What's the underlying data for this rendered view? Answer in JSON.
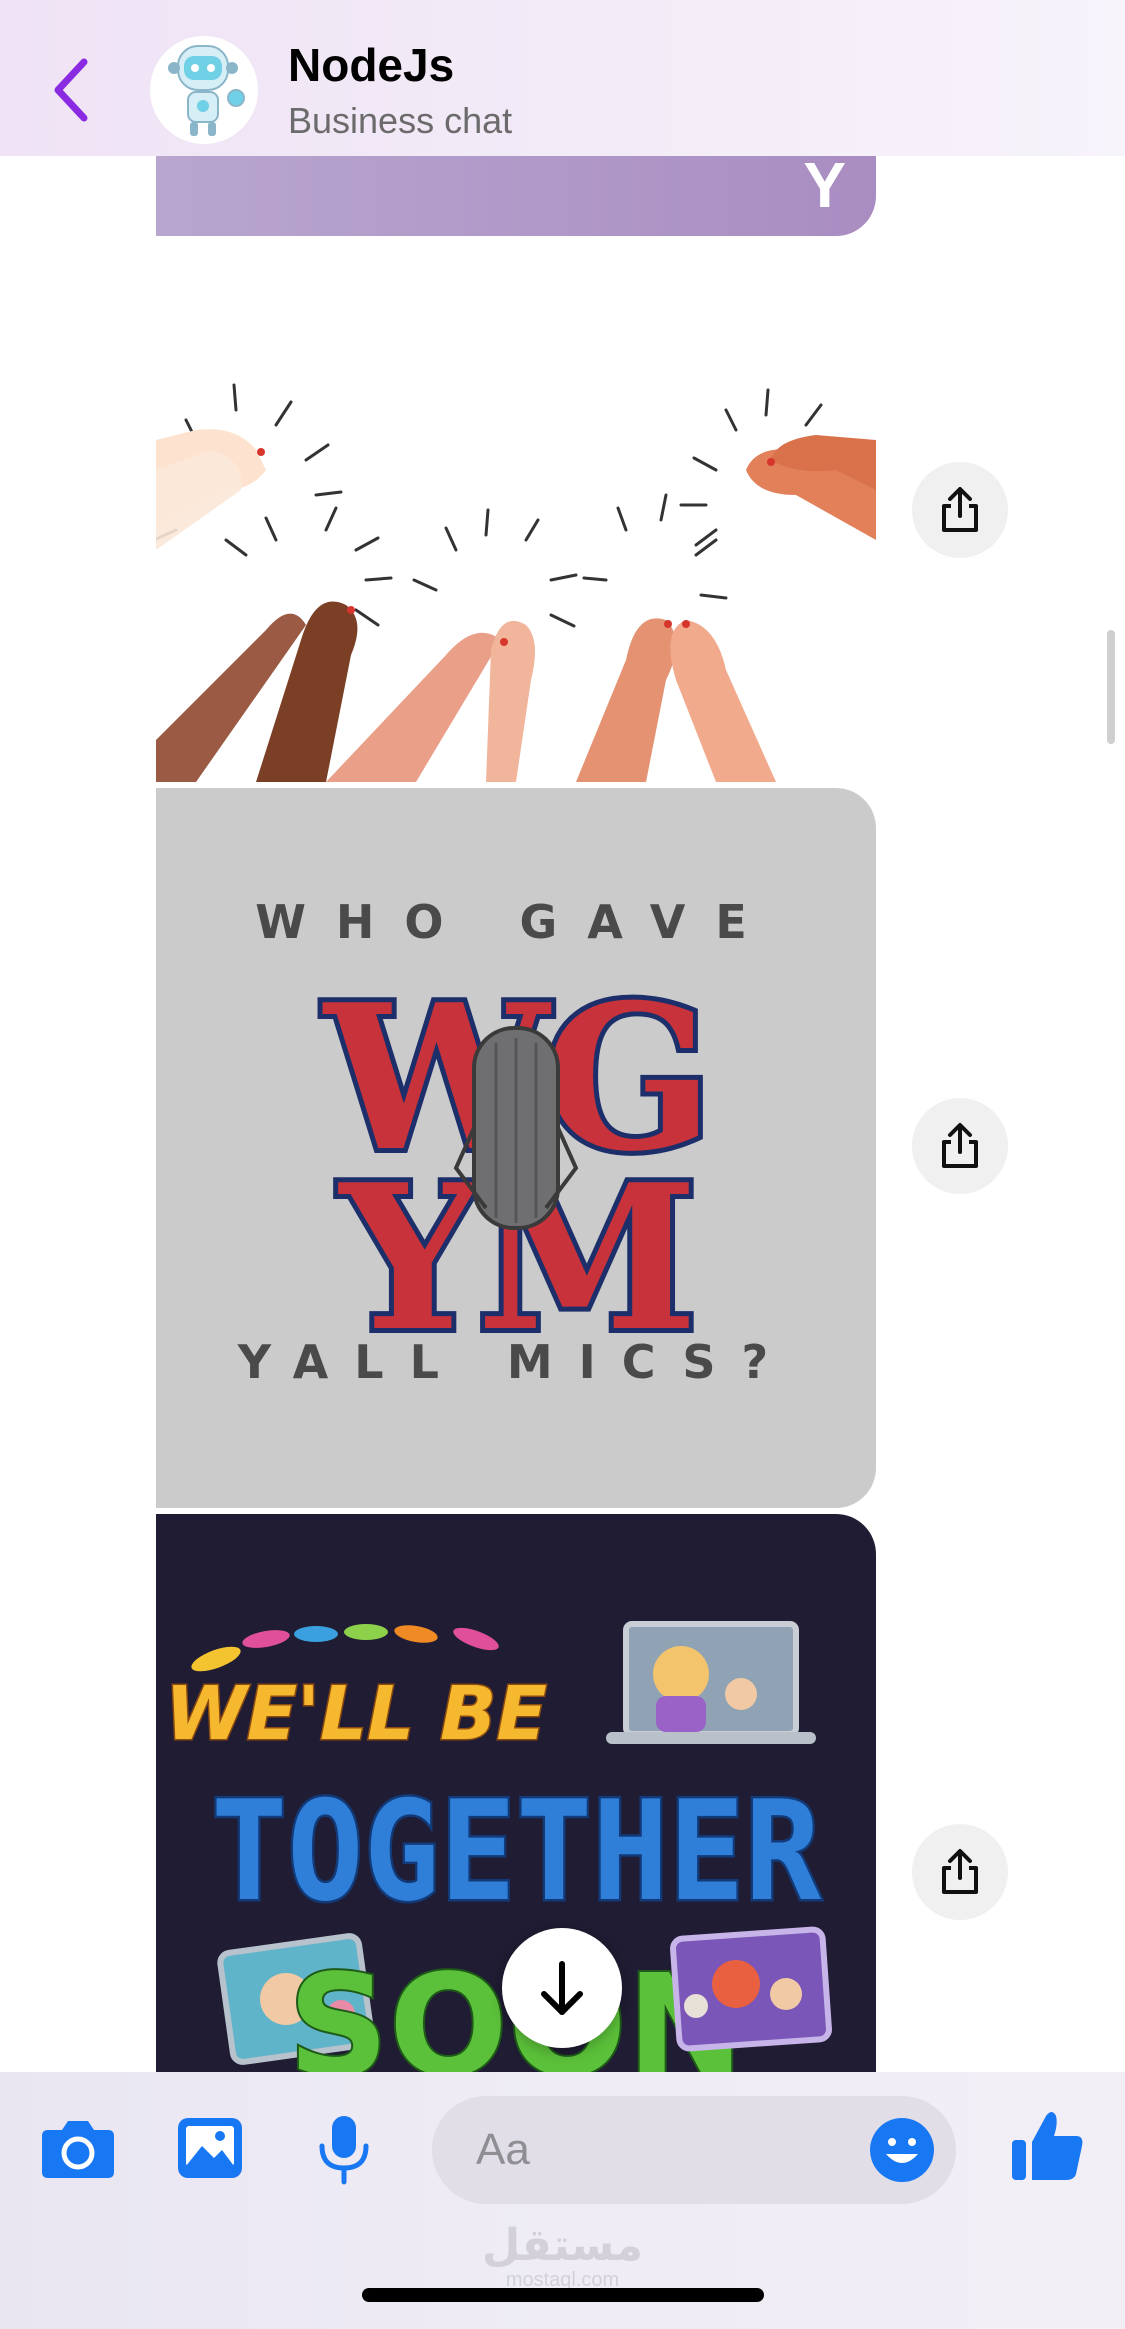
{
  "header": {
    "title": "NodeJs",
    "subtitle": "Business chat",
    "back_icon": "chevron-left-icon",
    "avatar_icon": "robot-avatar-icon"
  },
  "messages": {
    "previous_bubble_letter": "Y",
    "clap_image": {
      "icon": "clapping-hands-image"
    },
    "wgym_image": {
      "top_text": "WHO GAVE",
      "monogram_top": "WG",
      "monogram_bottom": "YM",
      "bottom_text": "YALL MICS?"
    },
    "together_image": {
      "line1": "WE'LL BE",
      "line2": "TOGETHER",
      "line3": "SOON"
    },
    "share_icon": "share-icon",
    "scroll_down_icon": "arrow-down-icon"
  },
  "composer": {
    "placeholder": "Aa",
    "icons": [
      "camera-icon",
      "gallery-icon",
      "microphone-icon",
      "emoji-icon",
      "thumbs-up-icon"
    ]
  },
  "watermark": {
    "arabic": "مستقل",
    "latin": "mostaql.com"
  },
  "colors": {
    "accent_purple": "#8a2be2",
    "messenger_blue": "#1877f2",
    "header_bg": "#efe3f5",
    "share_bg": "#f0f0f0"
  }
}
